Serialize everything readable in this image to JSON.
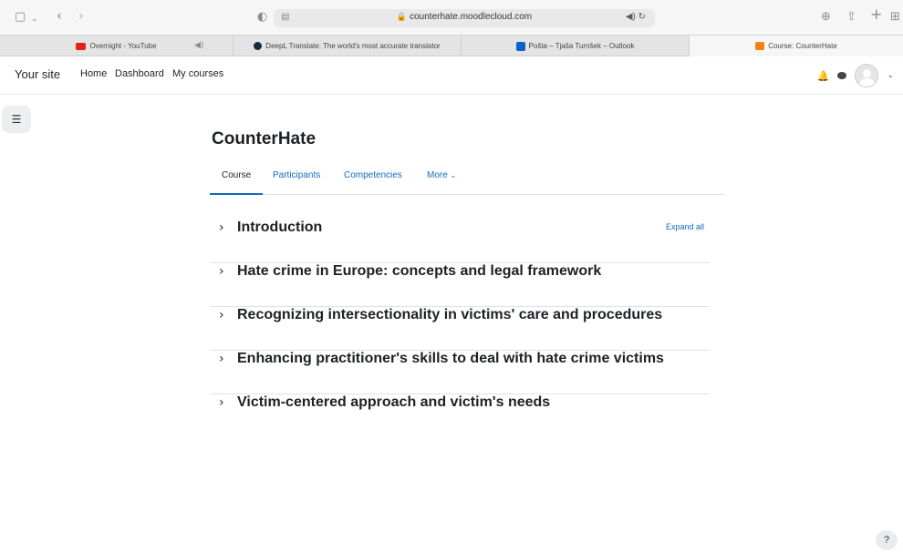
{
  "browser": {
    "url": "counterhate.moodlecloud.com",
    "tabs": [
      {
        "label": "Overnight - YouTube",
        "icon": "youtube-icon",
        "color": "#e62117"
      },
      {
        "label": "DeepL Translate: The world's most accurate translator",
        "icon": "deepl-icon",
        "color": "#0f2b46"
      },
      {
        "label": "Pošta – Tjaša Turnšek – Outlook",
        "icon": "outlook-icon",
        "color": "#0a64c8"
      },
      {
        "label": "Course: CounterHate",
        "icon": "moodle-icon",
        "color": "#f98012",
        "active": true
      }
    ]
  },
  "nav": {
    "brand": "Your site",
    "links": [
      "Home",
      "Dashboard",
      "My courses"
    ]
  },
  "course": {
    "title": "CounterHate",
    "tabs": [
      "Course",
      "Participants",
      "Competencies",
      "More"
    ],
    "active_tab": "Course",
    "expand_all": "Expand all",
    "sections": [
      "Introduction",
      "Hate crime in Europe: concepts and legal framework",
      "Recognizing intersectionality in victims' care and procedures",
      "Enhancing practitioner's skills to deal with hate crime victims",
      "Victim-centered approach and victim's needs"
    ]
  },
  "help_label": "?",
  "colors": {
    "link": "#0f6cbf",
    "text": "#1d2125"
  }
}
